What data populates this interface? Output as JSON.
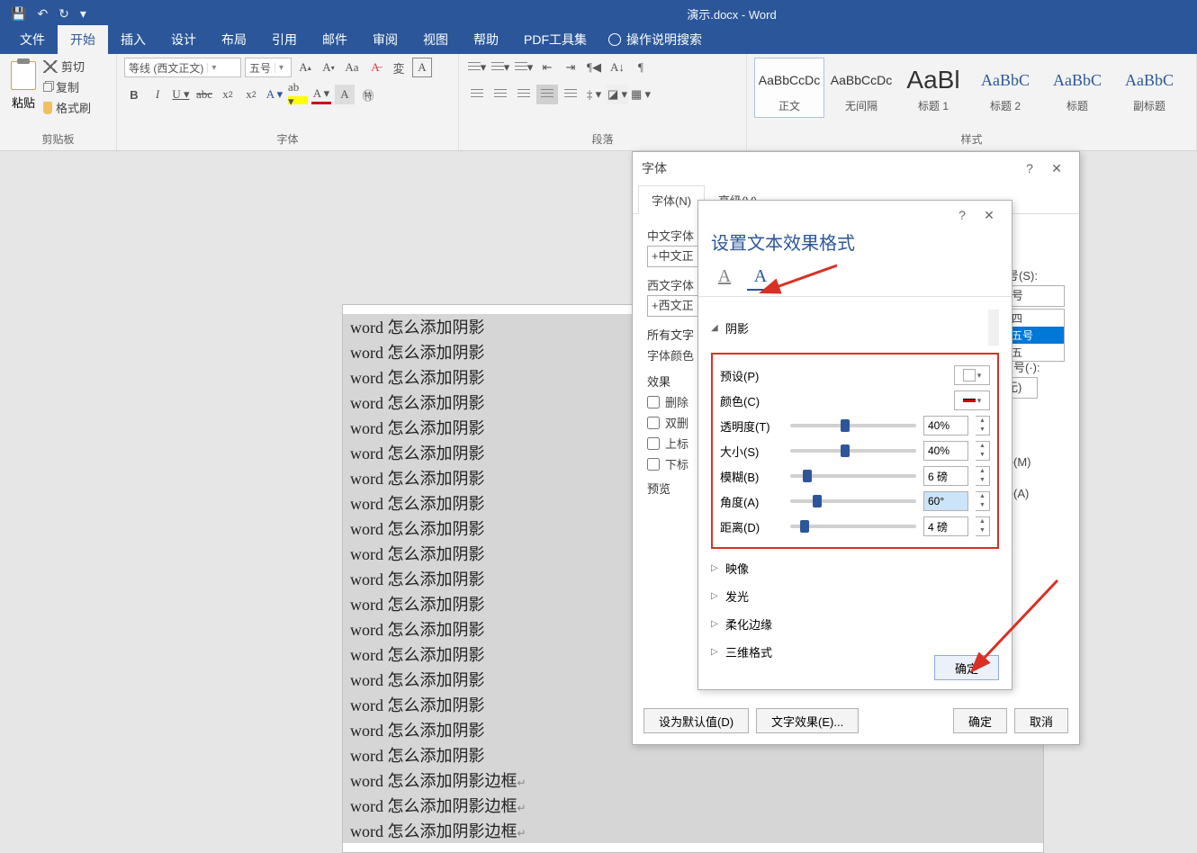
{
  "app": {
    "title": "演示.docx - Word"
  },
  "qat": {
    "save": "💾",
    "undo": "↶",
    "redo": "↻"
  },
  "tabs": [
    "文件",
    "开始",
    "插入",
    "设计",
    "布局",
    "引用",
    "邮件",
    "审阅",
    "视图",
    "帮助",
    "PDF工具集"
  ],
  "tabs_active": 1,
  "tell_me": "操作说明搜索",
  "clipboard": {
    "paste": "粘贴",
    "cut": "剪切",
    "copy": "复制",
    "brush": "格式刷",
    "label": "剪贴板"
  },
  "font_group": {
    "font_name": "等线 (西文正文)",
    "font_size": "五号",
    "buttons": [
      "B",
      "I",
      "U",
      "abc",
      "x₂",
      "x²",
      "A",
      "A",
      "A",
      "A",
      "A"
    ],
    "label": "字体"
  },
  "para_group": {
    "label": "段落"
  },
  "styles": {
    "items": [
      {
        "preview": "AaBbCcDc",
        "name": "正文",
        "sel": true,
        "cls": ""
      },
      {
        "preview": "AaBbCcDc",
        "name": "无间隔",
        "sel": false,
        "cls": ""
      },
      {
        "preview": "AaBl",
        "name": "标题 1",
        "sel": false,
        "cls": "big"
      },
      {
        "preview": "AaBbC",
        "name": "标题 2",
        "sel": false,
        "cls": "h2"
      },
      {
        "preview": "AaBbC",
        "name": "标题",
        "sel": false,
        "cls": "h3"
      },
      {
        "preview": "AaBbC",
        "name": "副标题",
        "sel": false,
        "cls": "h4"
      }
    ],
    "label": "样式"
  },
  "doc_line": "word 怎么添加阴影",
  "doc_line_full": "word 怎么添加阴影边框",
  "font_dialog": {
    "title": "字体",
    "tabs": [
      "字体(N)",
      "高级(V)"
    ],
    "cn_font_label": "中文字体",
    "cn_font": "+中文正",
    "en_font_label": "西文字体",
    "en_font": "+西文正",
    "all_label": "所有文字",
    "color_label": "字体颜色",
    "effects_label": "效果",
    "effects": [
      "删除",
      "双删",
      "上标",
      "下标"
    ],
    "preview_label": "预览",
    "size_label": "号(S):",
    "size_val": "号",
    "sizes": [
      "四",
      "五号",
      "五"
    ],
    "size_sel": 1,
    "extra_label1": "重号(·):",
    "extra_val1": "无)",
    "extra_label2": "略(M)",
    "extra_label3": "略(A)",
    "btn_default": "设为默认值(D)",
    "btn_fx": "文字效果(E)...",
    "btn_ok": "确定",
    "btn_cancel": "取消"
  },
  "fx_dialog": {
    "title": "设置文本效果格式",
    "cat_shadow": "阴影",
    "preset": "预设(P)",
    "color": "颜色(C)",
    "transparency": {
      "label": "透明度(T)",
      "value": "40%",
      "pos": 40
    },
    "size": {
      "label": "大小(S)",
      "value": "40%",
      "pos": 40
    },
    "blur": {
      "label": "模糊(B)",
      "value": "6 磅",
      "pos": 10
    },
    "angle": {
      "label": "角度(A)",
      "value": "60°",
      "pos": 18,
      "selected": true
    },
    "distance": {
      "label": "距离(D)",
      "value": "4 磅",
      "pos": 8
    },
    "cat_reflect": "映像",
    "cat_glow": "发光",
    "cat_soft": "柔化边缘",
    "cat_3d": "三维格式",
    "ok": "确定"
  }
}
